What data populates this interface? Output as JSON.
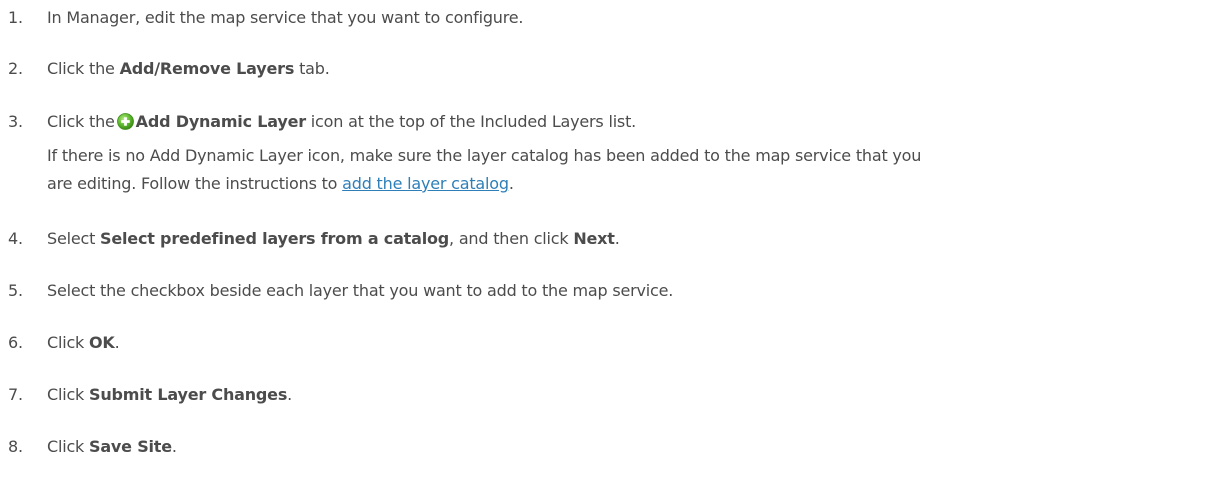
{
  "steps": [
    {
      "num": "1.",
      "text": "In Manager, edit the map service that you want to configure."
    },
    {
      "num": "2.",
      "pre": "Click the ",
      "bold": "Add/Remove Layers",
      "post": " tab."
    },
    {
      "num": "3.",
      "pre": "Click the",
      "bold": "Add Dynamic Layer",
      "post": " icon at the top of the Included Layers list.",
      "icon": "add-circle-icon"
    },
    {
      "num": "4.",
      "pre": "Select ",
      "bold": "Select predefined layers from a catalog",
      "mid": ", and then click ",
      "bold2": "Next",
      "post": "."
    },
    {
      "num": "5.",
      "text": "Select the checkbox beside each layer that you want to add to the map service."
    },
    {
      "num": "6.",
      "pre": "Click ",
      "bold": "OK",
      "post": "."
    },
    {
      "num": "7.",
      "pre": "Click ",
      "bold": "Submit Layer Changes",
      "post": "."
    },
    {
      "num": "8.",
      "pre": "Click ",
      "bold": "Save Site",
      "post": "."
    }
  ],
  "note": {
    "line1": "If there is no Add Dynamic Layer icon, make sure the layer catalog has been added to the map service that you",
    "line2_pre": "are editing. Follow the instructions to ",
    "link": "add the layer catalog",
    "line2_post": "."
  },
  "colors": {
    "text": "#4c4c4c",
    "link": "#2e7fb8",
    "icon_green": "#5cb82e"
  }
}
